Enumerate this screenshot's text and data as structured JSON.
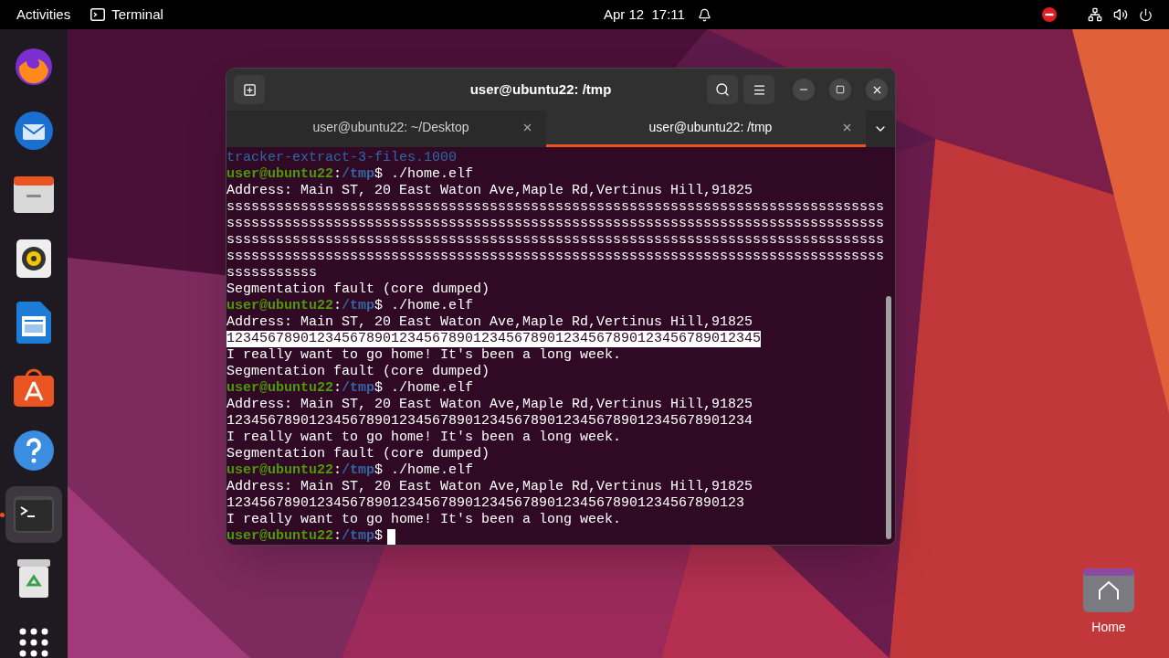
{
  "top_bar": {
    "activities": "Activities",
    "app": "Terminal",
    "clock": "Apr 12  17:11"
  },
  "dock": [
    {
      "kind": "browser",
      "selected": false
    },
    {
      "kind": "mail",
      "selected": false
    },
    {
      "kind": "files",
      "selected": false
    },
    {
      "kind": "music",
      "selected": false
    },
    {
      "kind": "document",
      "selected": false
    },
    {
      "kind": "store",
      "selected": false
    },
    {
      "kind": "help",
      "selected": false
    },
    {
      "kind": "terminal",
      "selected": true
    },
    {
      "kind": "trash",
      "selected": false
    },
    {
      "kind": "apps",
      "selected": false
    }
  ],
  "window": {
    "title": "user@ubuntu22: /tmp",
    "tabs": [
      {
        "label": "user@ubuntu22: ~/Desktop",
        "selected": false
      },
      {
        "label": "user@ubuntu22: /tmp",
        "selected": true
      }
    ],
    "lines": [
      {
        "kind": "dir",
        "text": "tracker-extract-3-files.1000"
      },
      {
        "kind": "prompt",
        "user": "user@ubuntu22",
        "sep": ":",
        "path": "/tmp",
        "symbol": "$",
        "command": " ./home.elf",
        "cursor": false
      },
      {
        "kind": "output",
        "text": "Address: Main ST, 20 East Waton Ave,Maple Rd,Vertinus Hill,91825",
        "selected": false
      },
      {
        "kind": "output",
        "text": "ssssssssssssssssssssssssssssssssssssssssssssssssssssssssssssssssssssssssssssssss",
        "selected": false
      },
      {
        "kind": "output",
        "text": "ssssssssssssssssssssssssssssssssssssssssssssssssssssssssssssssssssssssssssssssss",
        "selected": false
      },
      {
        "kind": "output",
        "text": "ssssssssssssssssssssssssssssssssssssssssssssssssssssssssssssssssssssssssssssssss",
        "selected": false
      },
      {
        "kind": "output",
        "text": "ssssssssssssssssssssssssssssssssssssssssssssssssssssssssssssssssssssssssssssssss",
        "selected": false
      },
      {
        "kind": "output",
        "text": "sssssssssss",
        "selected": false
      },
      {
        "kind": "output",
        "text": "Segmentation fault (core dumped)",
        "selected": false
      },
      {
        "kind": "prompt",
        "user": "user@ubuntu22",
        "sep": ":",
        "path": "/tmp",
        "symbol": "$",
        "command": " ./home.elf",
        "cursor": false
      },
      {
        "kind": "output",
        "text": "Address: Main ST, 20 East Waton Ave,Maple Rd,Vertinus Hill,91825",
        "selected": false
      },
      {
        "kind": "output",
        "text": "12345678901234567890123456789012345678901234567890123456789012345",
        "selected": true
      },
      {
        "kind": "output",
        "text": "I really want to go home! It's been a long week.",
        "selected": false
      },
      {
        "kind": "output",
        "text": "Segmentation fault (core dumped)",
        "selected": false
      },
      {
        "kind": "prompt",
        "user": "user@ubuntu22",
        "sep": ":",
        "path": "/tmp",
        "symbol": "$",
        "command": " ./home.elf",
        "cursor": false
      },
      {
        "kind": "output",
        "text": "Address: Main ST, 20 East Waton Ave,Maple Rd,Vertinus Hill,91825",
        "selected": false
      },
      {
        "kind": "output",
        "text": "1234567890123456789012345678901234567890123456789012345678901234",
        "selected": false
      },
      {
        "kind": "output",
        "text": "I really want to go home! It's been a long week.",
        "selected": false
      },
      {
        "kind": "output",
        "text": "Segmentation fault (core dumped)",
        "selected": false
      },
      {
        "kind": "prompt",
        "user": "user@ubuntu22",
        "sep": ":",
        "path": "/tmp",
        "symbol": "$",
        "command": " ./home.elf",
        "cursor": false
      },
      {
        "kind": "output",
        "text": "Address: Main ST, 20 East Waton Ave,Maple Rd,Vertinus Hill,91825",
        "selected": false
      },
      {
        "kind": "output",
        "text": "123456789012345678901234567890123456789012345678901234567890123",
        "selected": false
      },
      {
        "kind": "output",
        "text": "I really want to go home! It's been a long week.",
        "selected": false
      },
      {
        "kind": "prompt",
        "user": "user@ubuntu22",
        "sep": ":",
        "path": "/tmp",
        "symbol": "$",
        "cursor": true
      }
    ]
  },
  "desktop_icons": [
    {
      "label": "Home"
    }
  ]
}
